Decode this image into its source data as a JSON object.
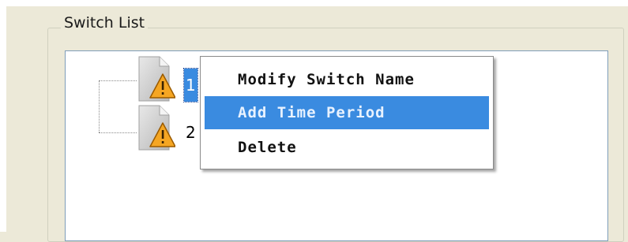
{
  "group": {
    "title": "Switch List"
  },
  "tree": {
    "items": [
      {
        "label": "1",
        "icon": "document-warning-icon",
        "selected": true
      },
      {
        "label": "2",
        "icon": "document-warning-icon",
        "selected": false
      }
    ]
  },
  "context_menu": {
    "items": [
      {
        "label": "Modify Switch Name",
        "highlighted": false
      },
      {
        "label": "Add Time Period",
        "highlighted": true
      },
      {
        "label": "Delete",
        "highlighted": false
      }
    ]
  },
  "colors": {
    "window_bg": "#ece9d8",
    "selection": "#3a8be0",
    "warning": "#f5a623"
  }
}
